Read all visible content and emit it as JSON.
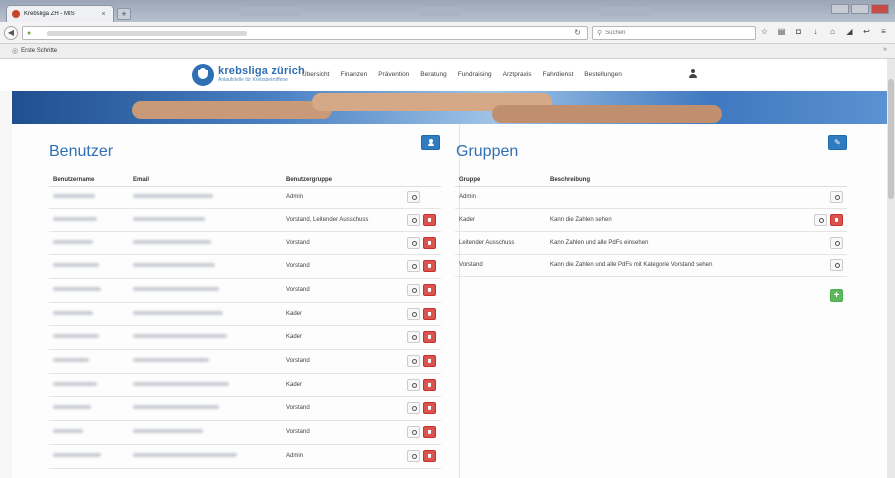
{
  "browser": {
    "tab_title": "Krebsliga ZH - MIS",
    "tab_close": "×",
    "new_tab": "+",
    "search_placeholder": "Suchen",
    "bookmark": "Erste Schritte"
  },
  "site": {
    "logo_name": "krebsliga zürich",
    "logo_tagline": "Anlaufstelle für Krebsbetroffene",
    "nav": [
      "Übersicht",
      "Finanzen",
      "Prävention",
      "Beratung",
      "Fundraising",
      "Arztpraxis",
      "Fahrdienst",
      "Bestellungen"
    ]
  },
  "users_panel": {
    "title": "Benutzer",
    "columns": [
      "Benutzername",
      "Email",
      "Benutzergruppe"
    ],
    "rows": [
      {
        "group": "Admin"
      },
      {
        "group": "Vorstand, Leitender Ausschuss"
      },
      {
        "group": "Vorstand"
      },
      {
        "group": "Vorstand"
      },
      {
        "group": "Vorstand"
      },
      {
        "group": "Kader"
      },
      {
        "group": "Kader"
      },
      {
        "group": "Vorstand"
      },
      {
        "group": "Kader"
      },
      {
        "group": "Vorstand"
      },
      {
        "group": "Vorstand"
      },
      {
        "group": "Admin"
      }
    ]
  },
  "groups_panel": {
    "title": "Gruppen",
    "columns": [
      "Gruppe",
      "Beschreibung"
    ],
    "rows": [
      {
        "name": "Admin",
        "description": ""
      },
      {
        "name": "Kader",
        "description": "Kann die Zahlen sehen"
      },
      {
        "name": "Leitender Ausschuss",
        "description": "Kann Zahlen und alle PdFs einsehen"
      },
      {
        "name": "Vorstand",
        "description": "Kann die Zahlen und alle PdFs mit Kategorie Vorstand sehen"
      }
    ],
    "add_button": "+"
  },
  "colors": {
    "brand_blue": "#2f6fb3",
    "danger": "#d9534f",
    "success": "#5cb85c"
  }
}
